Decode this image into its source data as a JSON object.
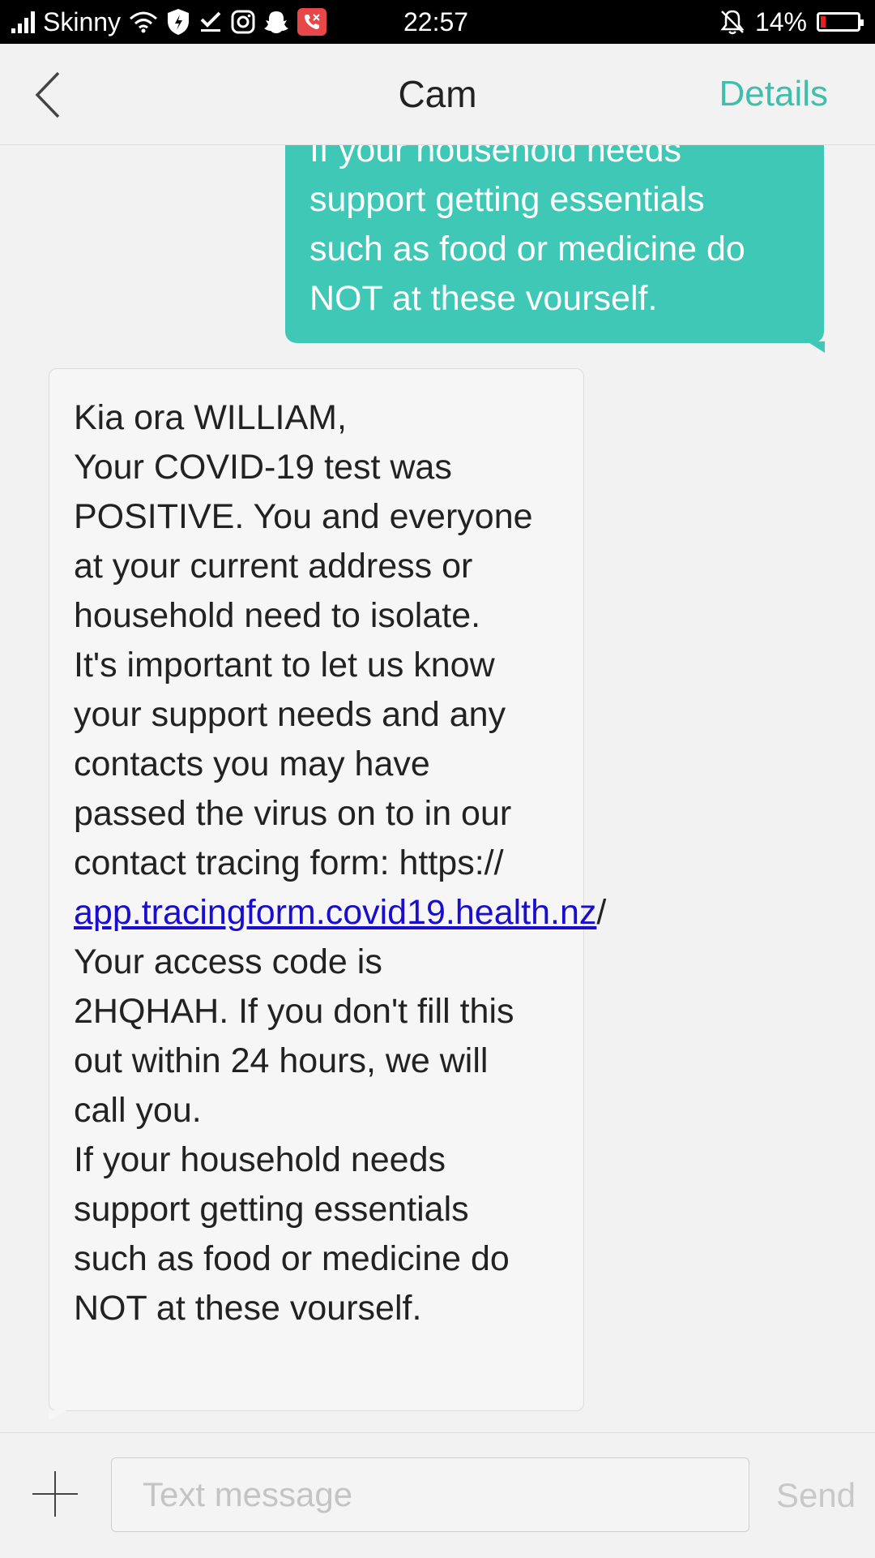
{
  "status_bar": {
    "carrier": "Skinny",
    "time": "22:57",
    "battery_percent": "14%",
    "battery_level": 0.14,
    "icons_left": [
      "signal-icon",
      "wifi-icon",
      "shield-icon",
      "check-icon",
      "instagram-icon",
      "snapchat-icon",
      "missed-call-icon"
    ],
    "icons_right": [
      "bell-off-icon",
      "battery-icon"
    ]
  },
  "header": {
    "back_icon": "chevron-left-icon",
    "title": "Cam",
    "details_label": "Details",
    "accent_color": "#3fbeab"
  },
  "messages": [
    {
      "direction": "outgoing",
      "color": "#40c8b6",
      "text": "If your household needs\nsupport getting essentials\nsuch as food or medicine do\nNOT at these vourself."
    },
    {
      "direction": "incoming",
      "color": "#f6f6f6",
      "text_before_link": "Kia ora WILLIAM,\nYour COVID-19 test was\nPOSITIVE. You and everyone\nat your current address or\nhousehold need to isolate.\nIt's important to let us know\nyour support needs and any\ncontacts you may have\npassed the virus on to in our\ncontact tracing form: https://\n",
      "link_text": "app.tracingform.covid19.health.nz",
      "text_after_link": "/\nYour access code is\n2HQHAH. If you don't fill this\nout within 24 hours, we will\ncall you.\nIf your household needs\nsupport getting essentials\nsuch as food or medicine do\nNOT at these vourself."
    }
  ],
  "composer": {
    "add_icon": "plus-icon",
    "placeholder": "Text message",
    "value": "",
    "send_label": "Send"
  }
}
